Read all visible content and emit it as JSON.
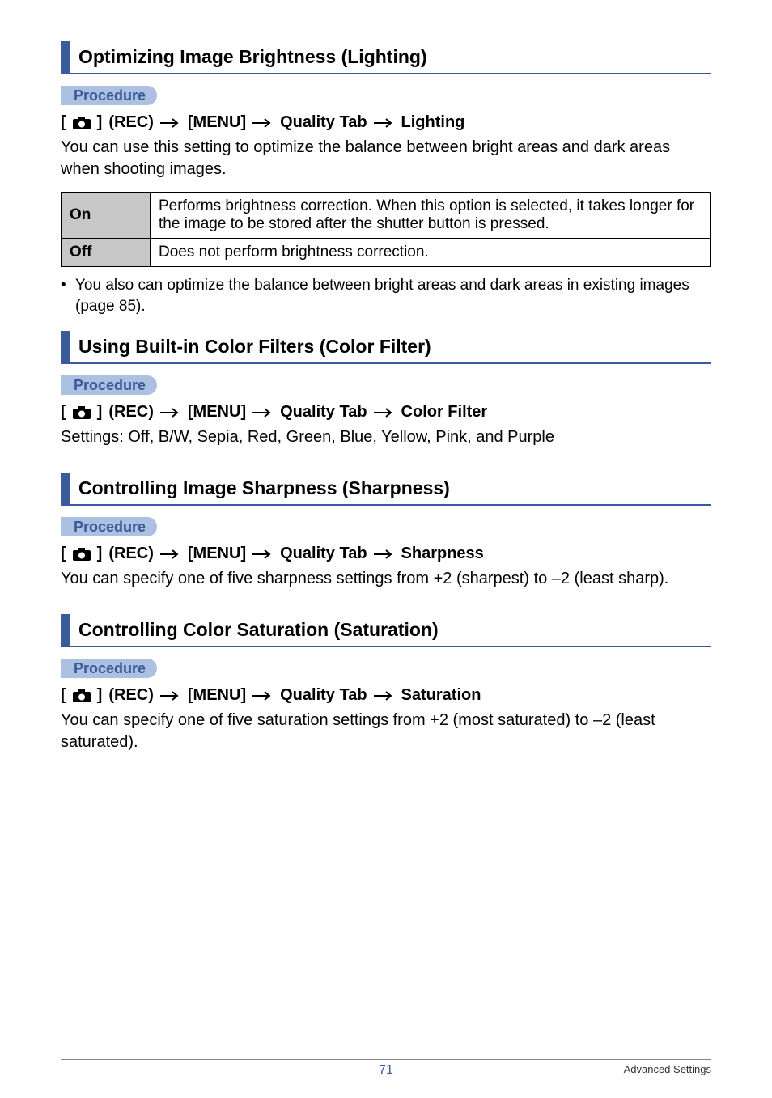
{
  "labels": {
    "procedure": "Procedure"
  },
  "sections": [
    {
      "title": "Optimizing Image Brightness (Lighting)",
      "breadcrumb": [
        "(REC)",
        "[MENU]",
        "Quality Tab",
        "Lighting"
      ],
      "intro": "You can use this setting to optimize the balance between bright areas and dark areas when shooting images.",
      "table": [
        {
          "label": "On",
          "desc": "Performs brightness correction. When this option is selected, it takes longer for the image to be stored after the shutter button is pressed."
        },
        {
          "label": "Off",
          "desc": "Does not perform brightness correction."
        }
      ],
      "bullet": "You also can optimize the balance between bright areas and dark areas in existing images (page 85)."
    },
    {
      "title": "Using Built-in Color Filters (Color Filter)",
      "breadcrumb": [
        "(REC)",
        "[MENU]",
        "Quality Tab",
        "Color Filter"
      ],
      "body": "Settings: Off, B/W, Sepia, Red, Green, Blue, Yellow, Pink, and Purple"
    },
    {
      "title": "Controlling Image Sharpness (Sharpness)",
      "breadcrumb": [
        "(REC)",
        "[MENU]",
        "Quality Tab",
        "Sharpness"
      ],
      "body": "You can specify one of five sharpness settings from +2 (sharpest) to –2 (least sharp)."
    },
    {
      "title": "Controlling Color Saturation (Saturation)",
      "breadcrumb": [
        "(REC)",
        "[MENU]",
        "Quality Tab",
        "Saturation"
      ],
      "body": "You can specify one of five saturation settings from +2 (most saturated) to –2 (least saturated)."
    }
  ],
  "footer": {
    "page": "71",
    "text": "Advanced Settings"
  }
}
